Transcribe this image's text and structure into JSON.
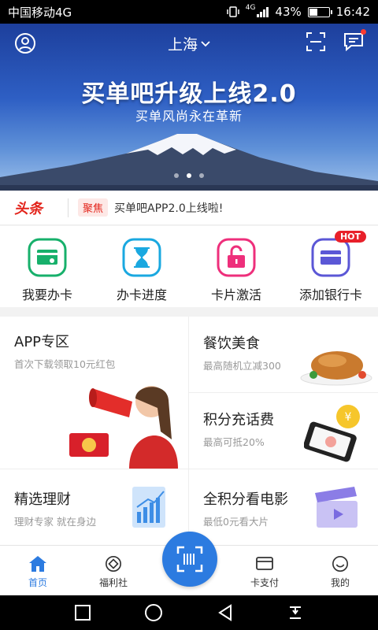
{
  "status_bar": {
    "carrier": "中国移动4G",
    "network": "4G",
    "battery": "43%",
    "battery_level": 0.43,
    "time": "16:42"
  },
  "header": {
    "city": "上海"
  },
  "banner": {
    "title": "买单吧升级上线2.0",
    "subtitle": "买单风尚永在革新",
    "slide_count": 3,
    "active_slide": 1
  },
  "headline": {
    "logo": "头条",
    "tag": "聚焦",
    "text": "买单吧APP2.0上线啦!"
  },
  "quick_actions": [
    {
      "label": "我要办卡",
      "icon": "card-apply-icon",
      "color": "#17b06b"
    },
    {
      "label": "办卡进度",
      "icon": "hourglass-icon",
      "color": "#1aa8e0"
    },
    {
      "label": "卡片激活",
      "icon": "unlock-icon",
      "color": "#ee2f7b"
    },
    {
      "label": "添加银行卡",
      "icon": "add-card-icon",
      "color": "#5b57d6",
      "badge": "HOT"
    }
  ],
  "grid": {
    "app_zone": {
      "title": "APP专区",
      "subtitle": "首次下载领取10元红包"
    },
    "food": {
      "title": "餐饮美食",
      "subtitle": "最高随机立减300"
    },
    "points_phone": {
      "title": "积分充话费",
      "subtitle": "最高可抵20%"
    },
    "finance": {
      "title": "精选理财",
      "subtitle": "理财专家 就在身边"
    },
    "movie": {
      "title": "全积分看电影",
      "subtitle": "最低0元看大片"
    }
  },
  "bottom_nav": [
    {
      "label": "首页",
      "icon": "home-icon",
      "active": true
    },
    {
      "label": "福利社",
      "icon": "welfare-icon",
      "active": false
    },
    {
      "label": "卡支付",
      "icon": "card-pay-icon",
      "active": false
    },
    {
      "label": "我的",
      "icon": "smile-icon",
      "active": false
    }
  ],
  "colors": {
    "brand_blue": "#2c7be0",
    "headline_red": "#e3241b"
  }
}
